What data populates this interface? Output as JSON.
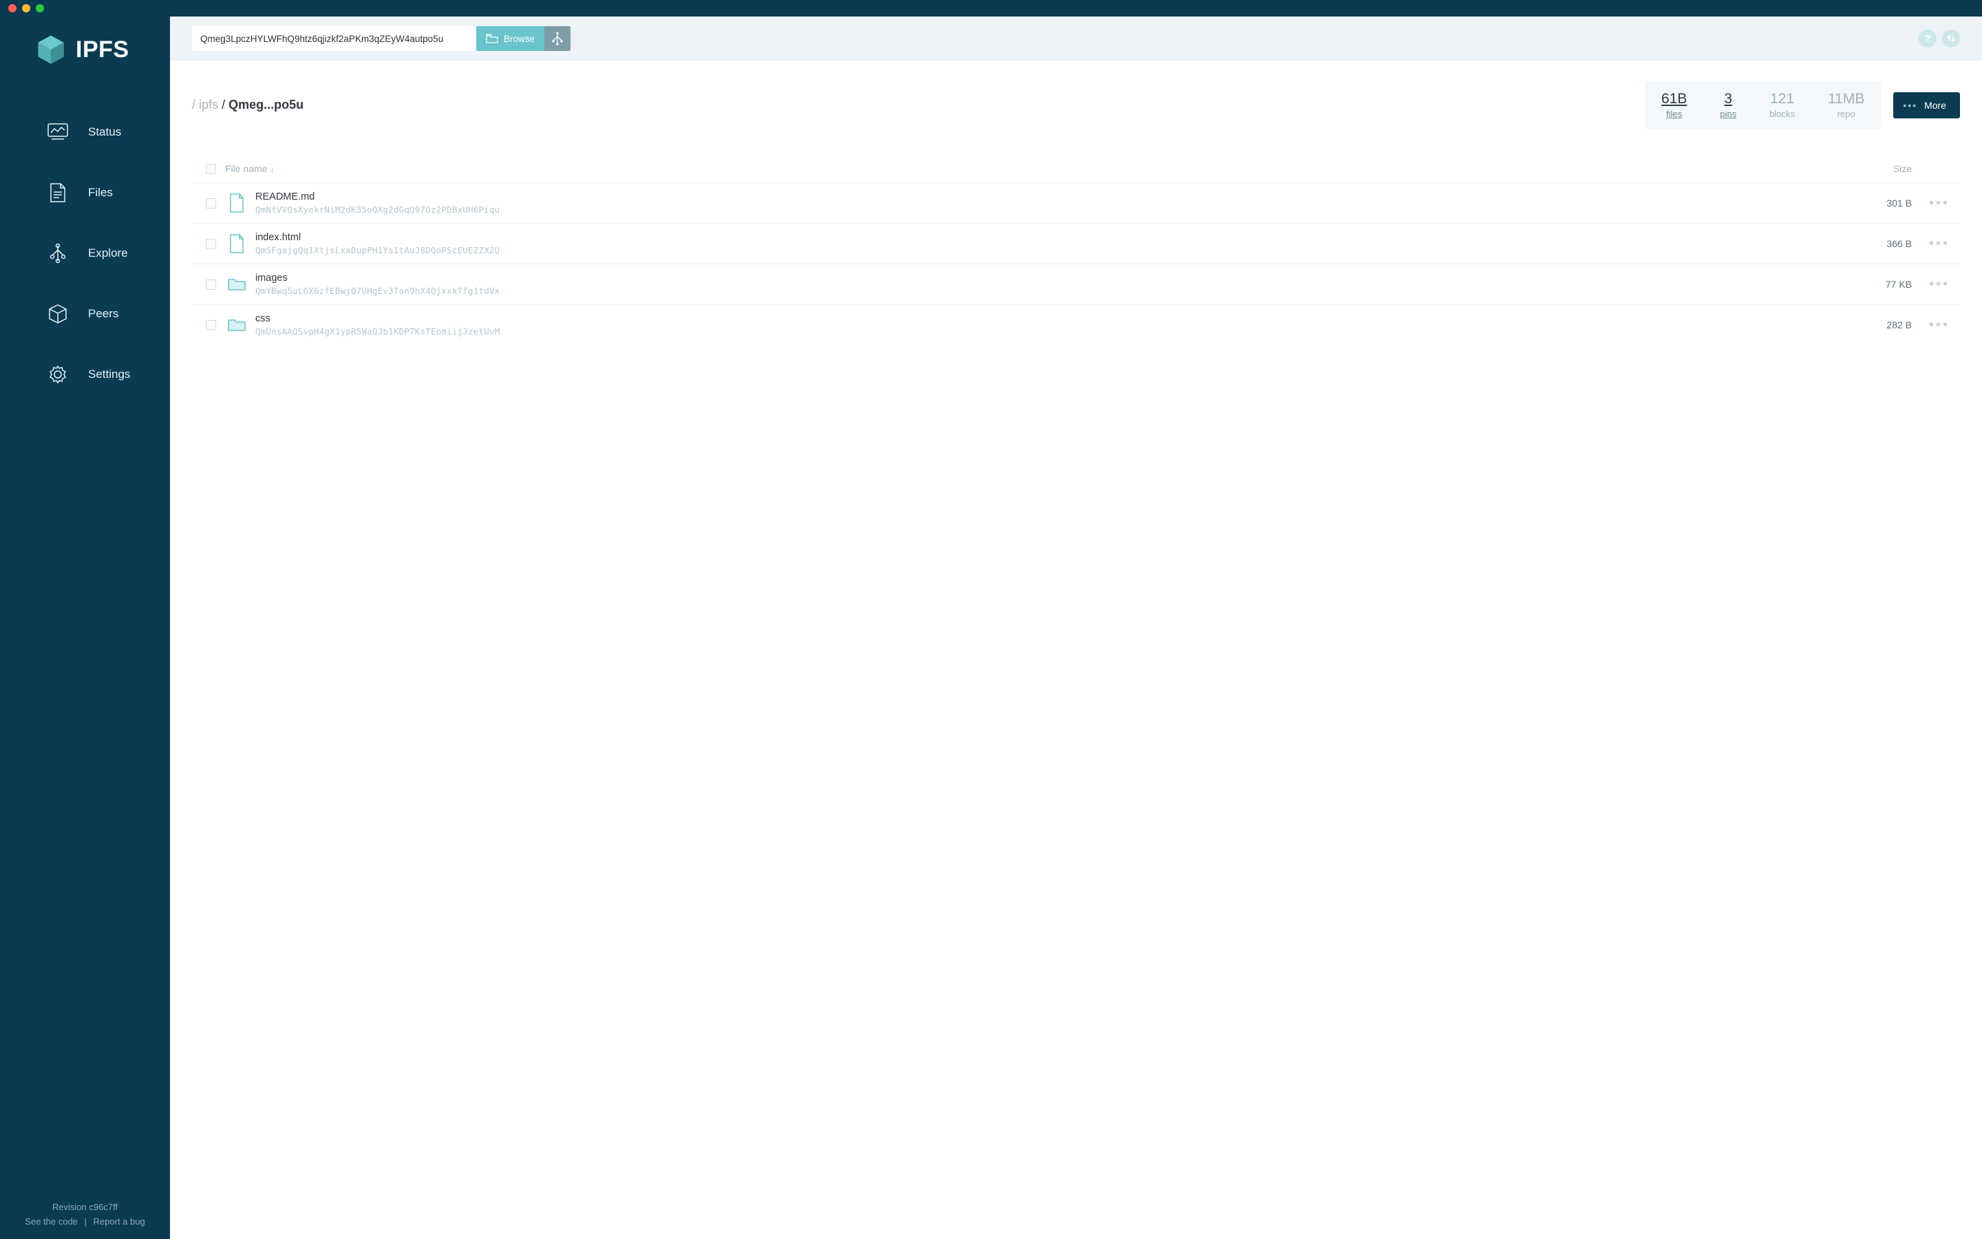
{
  "app": {
    "name": "IPFS"
  },
  "sidebar": {
    "items": [
      {
        "label": "Status"
      },
      {
        "label": "Files"
      },
      {
        "label": "Explore"
      },
      {
        "label": "Peers"
      },
      {
        "label": "Settings"
      }
    ],
    "footer": {
      "revision_label": "Revision c96c7ff",
      "see_code": "See the code",
      "report_bug": "Report a bug"
    }
  },
  "topbar": {
    "path_value": "Qmeg3LpczHYLWFhQ9htz6qjizkf2aPKm3qZEyW4autpo5u",
    "browse_label": "Browse"
  },
  "breadcrumb": {
    "slash": "/",
    "root": "ipfs",
    "current": "Qmeg...po5u"
  },
  "stats": [
    {
      "value": "61B",
      "label": "files",
      "link": true
    },
    {
      "value": "3",
      "label": "pins",
      "link": true
    },
    {
      "value": "121",
      "label": "blocks",
      "link": false
    },
    {
      "value": "11MB",
      "label": "repo",
      "link": false
    }
  ],
  "more_button": "More",
  "table": {
    "col_name": "File name",
    "col_size": "Size",
    "rows": [
      {
        "name": "README.md",
        "hash": "QmNfVVQsXyekrNiM2dK35oQXg2dGqQ97Gz2PDBxUH6Piqu",
        "size": "301 B",
        "type": "file"
      },
      {
        "name": "index.html",
        "hash": "QmSFgajgQq1XtjsLxxDupPH1Ys1tAuJ8DQoPScEUEZZX2U",
        "size": "366 B",
        "type": "file"
      },
      {
        "name": "images",
        "hash": "QmYBwq5uLGX6zfEBwjQ7UHgEv3Ton9hX4QjxxkTfg1tdVx",
        "size": "77 KB",
        "type": "folder"
      },
      {
        "name": "css",
        "hash": "QmUnsAAQ5vpH4gX1ypR5WaQJb1KDP7KsTEomiijJzetUvM",
        "size": "282 B",
        "type": "folder"
      }
    ]
  }
}
